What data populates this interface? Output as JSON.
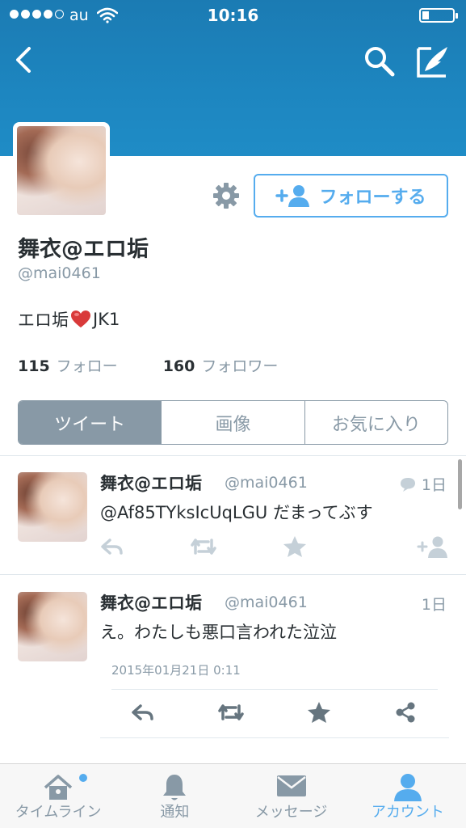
{
  "status_bar": {
    "carrier": "au",
    "time": "10:16"
  },
  "profile": {
    "display_name": "舞衣@エロ垢",
    "handle": "@mai0461",
    "bio_prefix": "エロ垢",
    "bio_emoji": "heart",
    "bio_suffix": "JK1",
    "following_count": "115",
    "following_label": "フォロー",
    "followers_count": "160",
    "followers_label": "フォロワー",
    "follow_button_label": "フォローする"
  },
  "segments": [
    {
      "label": "ツイート",
      "active": true
    },
    {
      "label": "画像",
      "active": false
    },
    {
      "label": "お気に入り",
      "active": false
    }
  ],
  "tweets": [
    {
      "name": "舞衣@エロ垢",
      "handle": "@mai0461",
      "time": "1日",
      "text": "@Af85TYksIcUqLGU だまってぶす"
    },
    {
      "name": "舞衣@エロ垢",
      "handle": "@mai0461",
      "time": "1日",
      "text": "え。わたしも悪口言われた泣泣",
      "date": "2015年01月21日 0:11"
    }
  ],
  "tabbar": [
    {
      "label": "タイムライン",
      "icon": "home-icon",
      "active": false,
      "badge": true
    },
    {
      "label": "通知",
      "icon": "bell-icon",
      "active": false
    },
    {
      "label": "メッセージ",
      "icon": "envelope-icon",
      "active": false
    },
    {
      "label": "アカウント",
      "icon": "person-icon",
      "active": true
    }
  ],
  "colors": {
    "accent": "#55acee",
    "banner": "#1d86c0",
    "muted": "#8899a6",
    "text": "#292f33"
  }
}
